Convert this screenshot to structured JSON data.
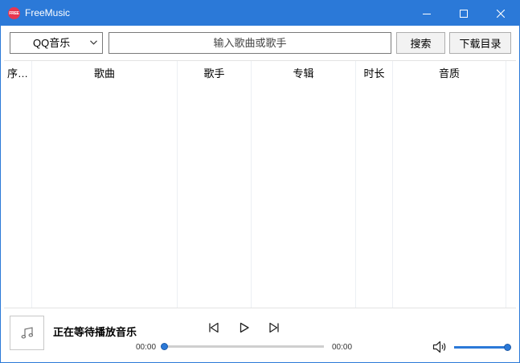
{
  "window": {
    "title": "FreeMusic",
    "app_icon_text": "FREE",
    "accent_color": "#2b79d8",
    "icon_color": "#e8364f"
  },
  "toolbar": {
    "source_selected": "QQ音乐",
    "search_placeholder": "输入歌曲或歌手",
    "search_value": "",
    "search_button": "搜索",
    "download_dir_button": "下载目录"
  },
  "table": {
    "columns": [
      "序号",
      "歌曲",
      "歌手",
      "专辑",
      "时长",
      "音质"
    ],
    "column_display": [
      "序…",
      "歌曲",
      "歌手",
      "专辑",
      "时长",
      "音质"
    ],
    "rows": []
  },
  "player": {
    "status": "正在等待播放音乐",
    "current_time": "00:00",
    "total_time": "00:00",
    "progress": 0,
    "volume": 1.0
  }
}
